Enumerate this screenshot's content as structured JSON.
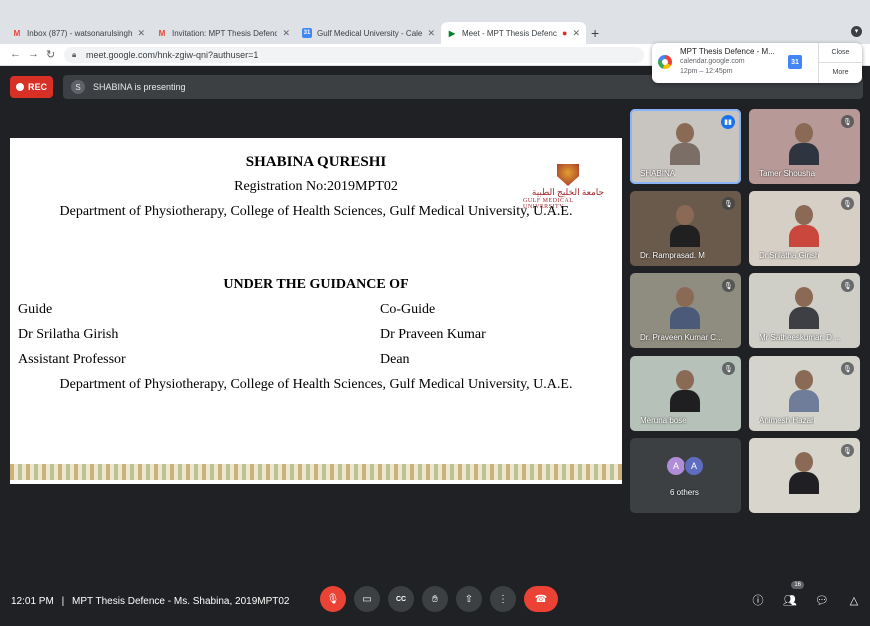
{
  "browser": {
    "tabs": [
      {
        "icon": "gmail-icon",
        "title": "Inbox (877) - watsonarulsingh@"
      },
      {
        "icon": "gmail-icon",
        "title": "Invitation: MPT Thesis Defence"
      },
      {
        "icon": "calendar-icon",
        "title": "Gulf Medical University - Calen"
      },
      {
        "icon": "meet-icon",
        "title": "Meet - MPT Thesis Defenc"
      }
    ],
    "new_tab": "+",
    "url": "meet.google.com/hnk-zgiw-qni?authuser=1"
  },
  "notification": {
    "title": "MPT Thesis Defence  - M...",
    "source": "calendar.google.com",
    "time": "12pm – 12:45pm",
    "close_label": "Close",
    "more_label": "More"
  },
  "meet": {
    "rec_label": "REC",
    "presenter_initial": "S",
    "presenting_text": "SHABINA is presenting",
    "slide": {
      "name": "SHABINA QURESHI",
      "registration": "Registration No:2019MPT02",
      "department": "Department of Physiotherapy, College of Health Sciences, Gulf Medical University, U.A.E.",
      "guidance_heading": "UNDER THE GUIDANCE OF",
      "guide_label": "Guide",
      "guide_name": "Dr Srilatha Girish",
      "guide_title": "Assistant Professor",
      "coguide_label": "Co-Guide",
      "coguide_name": "Dr Praveen Kumar",
      "coguide_title": "Dean",
      "department2": "Department of Physiotherapy, College of Health Sciences, Gulf Medical University, U.A.E.",
      "logo_arabic": "جامعة الخليج الطبية",
      "logo_english": "GULF MEDICAL UNIVERSITY"
    },
    "participants": [
      {
        "name": "SHABINA",
        "bg": "#c8c4bf",
        "shirt": "#7a6e66"
      },
      {
        "name": "Tamer Shousha",
        "bg": "#b79a98",
        "shirt": "#2e3440"
      },
      {
        "name": "Dr. Ramprasad. M",
        "bg": "#6a5a4c",
        "shirt": "#202020"
      },
      {
        "name": "Dr.Srilatha Girish",
        "bg": "#d6cfc6",
        "shirt": "#c9473c"
      },
      {
        "name": "Dr. Praveen Kumar C...",
        "bg": "#8f8d80",
        "shirt": "#4c5a7a"
      },
      {
        "name": "Mr Satheeskumar. D ...",
        "bg": "#cfcfc8",
        "shirt": "#3e3f44"
      },
      {
        "name": "Meruna bose",
        "bg": "#b5c1b9",
        "shirt": "#1f1f22"
      },
      {
        "name": "Animesh Hazari",
        "bg": "#d4d4cc",
        "shirt": "#6f7d9a"
      },
      {
        "name": "",
        "bg": "#d8d6cc",
        "shirt": "#202024"
      }
    ],
    "others": {
      "label": "6 others",
      "avatars": [
        "A",
        "A"
      ],
      "colors": [
        "#b18cd8",
        "#5f6dc1"
      ]
    },
    "time": "12:01 PM",
    "separator": "|",
    "meeting_title": "MPT Thesis Defence - Ms. Shabina, 2019MPT02",
    "people_count": "16"
  }
}
